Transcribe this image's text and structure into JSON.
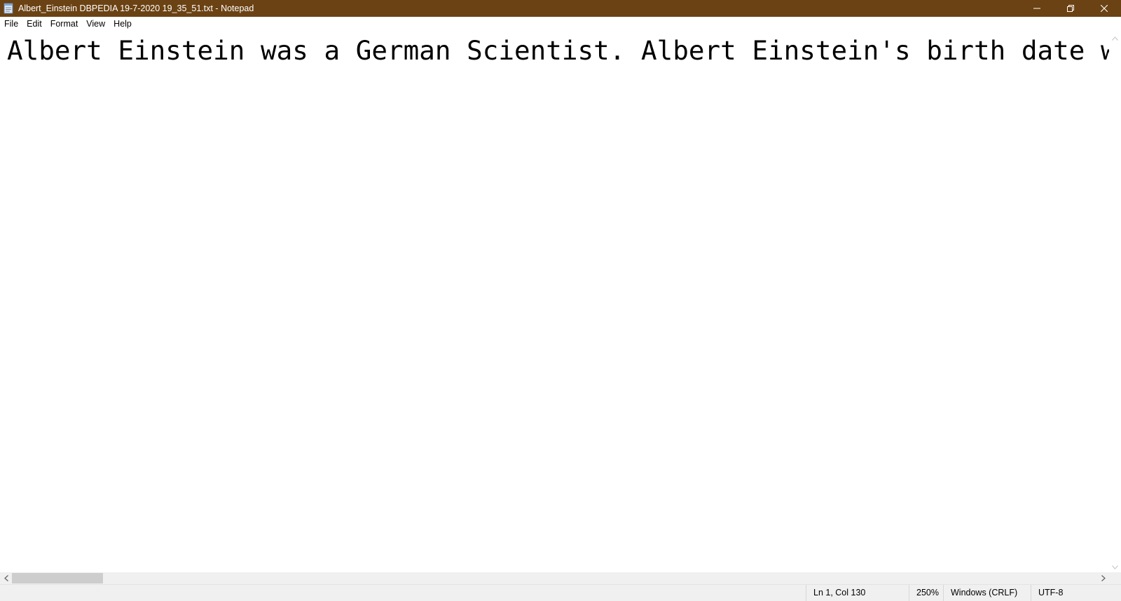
{
  "colors": {
    "titlebar_bg": "#6b4213",
    "titlebar_text": "#ffffff",
    "statusbar_bg": "#f0f0f0"
  },
  "titlebar": {
    "title": "Albert_Einstein DBPEDIA 19-7-2020 19_35_51.txt - Notepad",
    "icon": "notepad-icon",
    "controls": {
      "minimize_icon": "minimize-icon",
      "maximize_icon": "restore-icon",
      "close_icon": "close-icon"
    }
  },
  "menu": {
    "items": [
      {
        "label": "File"
      },
      {
        "label": "Edit"
      },
      {
        "label": "Format"
      },
      {
        "label": "View"
      },
      {
        "label": "Help"
      }
    ]
  },
  "editor": {
    "content": "Albert Einstein was a German Scientist. Albert Einstein's birth date was Ma"
  },
  "statusbar": {
    "position": "Ln 1, Col 130",
    "zoom": "250%",
    "line_endings": "Windows (CRLF)",
    "encoding": "UTF-8"
  }
}
